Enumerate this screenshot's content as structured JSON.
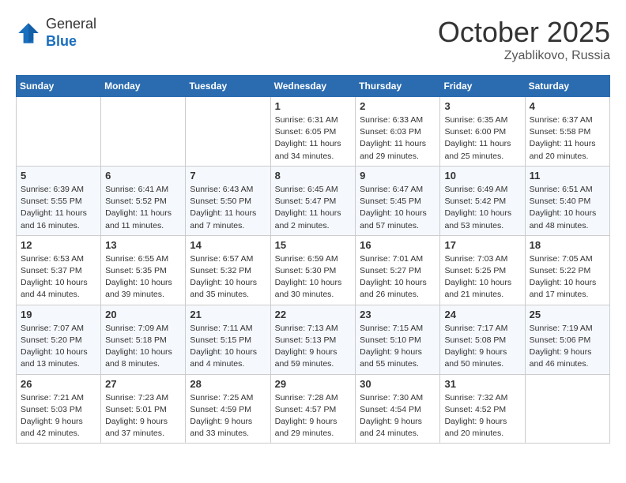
{
  "header": {
    "logo_general": "General",
    "logo_blue": "Blue",
    "month_title": "October 2025",
    "location": "Zyablikovo, Russia"
  },
  "weekdays": [
    "Sunday",
    "Monday",
    "Tuesday",
    "Wednesday",
    "Thursday",
    "Friday",
    "Saturday"
  ],
  "weeks": [
    [
      {
        "day": "",
        "info": ""
      },
      {
        "day": "",
        "info": ""
      },
      {
        "day": "",
        "info": ""
      },
      {
        "day": "1",
        "info": "Sunrise: 6:31 AM\nSunset: 6:05 PM\nDaylight: 11 hours\nand 34 minutes."
      },
      {
        "day": "2",
        "info": "Sunrise: 6:33 AM\nSunset: 6:03 PM\nDaylight: 11 hours\nand 29 minutes."
      },
      {
        "day": "3",
        "info": "Sunrise: 6:35 AM\nSunset: 6:00 PM\nDaylight: 11 hours\nand 25 minutes."
      },
      {
        "day": "4",
        "info": "Sunrise: 6:37 AM\nSunset: 5:58 PM\nDaylight: 11 hours\nand 20 minutes."
      }
    ],
    [
      {
        "day": "5",
        "info": "Sunrise: 6:39 AM\nSunset: 5:55 PM\nDaylight: 11 hours\nand 16 minutes."
      },
      {
        "day": "6",
        "info": "Sunrise: 6:41 AM\nSunset: 5:52 PM\nDaylight: 11 hours\nand 11 minutes."
      },
      {
        "day": "7",
        "info": "Sunrise: 6:43 AM\nSunset: 5:50 PM\nDaylight: 11 hours\nand 7 minutes."
      },
      {
        "day": "8",
        "info": "Sunrise: 6:45 AM\nSunset: 5:47 PM\nDaylight: 11 hours\nand 2 minutes."
      },
      {
        "day": "9",
        "info": "Sunrise: 6:47 AM\nSunset: 5:45 PM\nDaylight: 10 hours\nand 57 minutes."
      },
      {
        "day": "10",
        "info": "Sunrise: 6:49 AM\nSunset: 5:42 PM\nDaylight: 10 hours\nand 53 minutes."
      },
      {
        "day": "11",
        "info": "Sunrise: 6:51 AM\nSunset: 5:40 PM\nDaylight: 10 hours\nand 48 minutes."
      }
    ],
    [
      {
        "day": "12",
        "info": "Sunrise: 6:53 AM\nSunset: 5:37 PM\nDaylight: 10 hours\nand 44 minutes."
      },
      {
        "day": "13",
        "info": "Sunrise: 6:55 AM\nSunset: 5:35 PM\nDaylight: 10 hours\nand 39 minutes."
      },
      {
        "day": "14",
        "info": "Sunrise: 6:57 AM\nSunset: 5:32 PM\nDaylight: 10 hours\nand 35 minutes."
      },
      {
        "day": "15",
        "info": "Sunrise: 6:59 AM\nSunset: 5:30 PM\nDaylight: 10 hours\nand 30 minutes."
      },
      {
        "day": "16",
        "info": "Sunrise: 7:01 AM\nSunset: 5:27 PM\nDaylight: 10 hours\nand 26 minutes."
      },
      {
        "day": "17",
        "info": "Sunrise: 7:03 AM\nSunset: 5:25 PM\nDaylight: 10 hours\nand 21 minutes."
      },
      {
        "day": "18",
        "info": "Sunrise: 7:05 AM\nSunset: 5:22 PM\nDaylight: 10 hours\nand 17 minutes."
      }
    ],
    [
      {
        "day": "19",
        "info": "Sunrise: 7:07 AM\nSunset: 5:20 PM\nDaylight: 10 hours\nand 13 minutes."
      },
      {
        "day": "20",
        "info": "Sunrise: 7:09 AM\nSunset: 5:18 PM\nDaylight: 10 hours\nand 8 minutes."
      },
      {
        "day": "21",
        "info": "Sunrise: 7:11 AM\nSunset: 5:15 PM\nDaylight: 10 hours\nand 4 minutes."
      },
      {
        "day": "22",
        "info": "Sunrise: 7:13 AM\nSunset: 5:13 PM\nDaylight: 9 hours\nand 59 minutes."
      },
      {
        "day": "23",
        "info": "Sunrise: 7:15 AM\nSunset: 5:10 PM\nDaylight: 9 hours\nand 55 minutes."
      },
      {
        "day": "24",
        "info": "Sunrise: 7:17 AM\nSunset: 5:08 PM\nDaylight: 9 hours\nand 50 minutes."
      },
      {
        "day": "25",
        "info": "Sunrise: 7:19 AM\nSunset: 5:06 PM\nDaylight: 9 hours\nand 46 minutes."
      }
    ],
    [
      {
        "day": "26",
        "info": "Sunrise: 7:21 AM\nSunset: 5:03 PM\nDaylight: 9 hours\nand 42 minutes."
      },
      {
        "day": "27",
        "info": "Sunrise: 7:23 AM\nSunset: 5:01 PM\nDaylight: 9 hours\nand 37 minutes."
      },
      {
        "day": "28",
        "info": "Sunrise: 7:25 AM\nSunset: 4:59 PM\nDaylight: 9 hours\nand 33 minutes."
      },
      {
        "day": "29",
        "info": "Sunrise: 7:28 AM\nSunset: 4:57 PM\nDaylight: 9 hours\nand 29 minutes."
      },
      {
        "day": "30",
        "info": "Sunrise: 7:30 AM\nSunset: 4:54 PM\nDaylight: 9 hours\nand 24 minutes."
      },
      {
        "day": "31",
        "info": "Sunrise: 7:32 AM\nSunset: 4:52 PM\nDaylight: 9 hours\nand 20 minutes."
      },
      {
        "day": "",
        "info": ""
      }
    ]
  ]
}
